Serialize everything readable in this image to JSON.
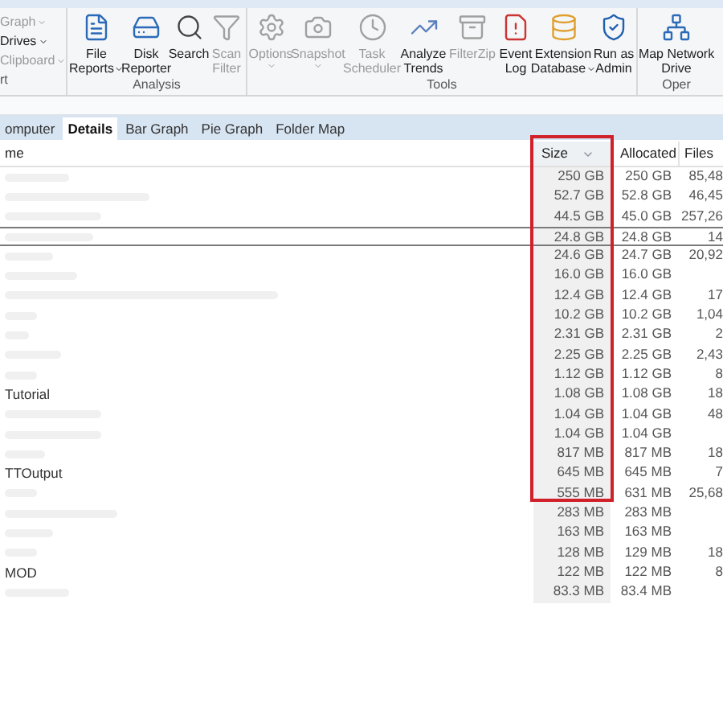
{
  "ribbon": {
    "left_items": [
      {
        "label": "Graph",
        "dropdown": true,
        "disabled": true
      },
      {
        "label": "Drives",
        "dropdown": true,
        "disabled": false
      },
      {
        "label": "Clipboard",
        "dropdown": true,
        "disabled": true
      }
    ],
    "left_group": "rt",
    "groups": [
      {
        "label": "Analysis",
        "buttons": [
          {
            "line1": "File",
            "line2": "Reports",
            "dropdown": true,
            "disabled": false
          },
          {
            "line1": "Disk",
            "line2": "Reporter",
            "dropdown": false,
            "disabled": false
          },
          {
            "line1": "Search",
            "dropdown": false,
            "disabled": false
          },
          {
            "line1": "Scan",
            "line2": "Filter",
            "dropdown": false,
            "disabled": true
          }
        ]
      },
      {
        "label": "Tools",
        "buttons": [
          {
            "line1": "Options",
            "dropdown": true,
            "disabled": true
          },
          {
            "line1": "Snapshot",
            "dropdown": true,
            "disabled": true
          },
          {
            "line1": "Task",
            "line2": "Scheduler",
            "dropdown": false,
            "disabled": true
          },
          {
            "line1": "Analyze",
            "line2": "Trends",
            "dropdown": false,
            "disabled": false
          },
          {
            "line1": "FilterZip",
            "dropdown": false,
            "disabled": true
          },
          {
            "line1": "Event",
            "line2": "Log",
            "dropdown": false,
            "disabled": false
          },
          {
            "line1": "Extension",
            "line2": "Database",
            "dropdown": true,
            "disabled": false
          },
          {
            "line1": "Run as",
            "line2": "Admin",
            "dropdown": false,
            "disabled": false
          }
        ]
      },
      {
        "label": "Oper",
        "buttons": [
          {
            "line1": "Map Network",
            "line2": "Drive",
            "dropdown": false,
            "disabled": false
          }
        ]
      }
    ]
  },
  "tabs": [
    {
      "label": "omputer",
      "selected": false
    },
    {
      "label": "Details",
      "selected": true
    },
    {
      "label": "Bar Graph",
      "selected": false
    },
    {
      "label": "Pie Graph",
      "selected": false
    },
    {
      "label": "Folder Map",
      "selected": false
    }
  ],
  "table": {
    "columns": [
      {
        "label": "me",
        "sorted": false
      },
      {
        "label": "Size",
        "sorted": true
      },
      {
        "label": "Allocated",
        "sorted": false
      },
      {
        "label": "Files",
        "sorted": false
      }
    ],
    "rows": [
      {
        "size": "250 GB",
        "allocated": "250 GB",
        "files": "85,48",
        "selected": false
      },
      {
        "size": "52.7 GB",
        "allocated": "52.8 GB",
        "files": "46,45",
        "selected": false
      },
      {
        "size": "44.5 GB",
        "allocated": "45.0 GB",
        "files": "257,26",
        "selected": false
      },
      {
        "size": "24.8 GB",
        "allocated": "24.8 GB",
        "files": "14",
        "selected": true
      },
      {
        "size": "24.6 GB",
        "allocated": "24.7 GB",
        "files": "20,92",
        "selected": false
      },
      {
        "size": "16.0 GB",
        "allocated": "16.0 GB",
        "selected": false
      },
      {
        "size": "12.4 GB",
        "allocated": "12.4 GB",
        "files": "17",
        "selected": false
      },
      {
        "size": "10.2 GB",
        "allocated": "10.2 GB",
        "files": "1,04",
        "selected": false
      },
      {
        "size": "2.31 GB",
        "allocated": "2.31 GB",
        "files": "2",
        "selected": false
      },
      {
        "size": "2.25 GB",
        "allocated": "2.25 GB",
        "files": "2,43",
        "selected": false
      },
      {
        "size": "1.12 GB",
        "allocated": "1.12 GB",
        "files": "8",
        "selected": false
      },
      {
        "name": "Tutorial",
        "size": "1.08 GB",
        "allocated": "1.08 GB",
        "files": "18",
        "selected": false
      },
      {
        "size": "1.04 GB",
        "allocated": "1.04 GB",
        "files": "48",
        "selected": false
      },
      {
        "size": "1.04 GB",
        "allocated": "1.04 GB",
        "selected": false
      },
      {
        "size": "817 MB",
        "allocated": "817 MB",
        "files": "18",
        "selected": false
      },
      {
        "name": "TTOutput",
        "size": "645 MB",
        "allocated": "645 MB",
        "files": "7",
        "selected": false
      },
      {
        "size": "555 MB",
        "allocated": "631 MB",
        "files": "25,68",
        "selected": false
      },
      {
        "size": "283 MB",
        "allocated": "283 MB",
        "selected": false
      },
      {
        "size": "163 MB",
        "allocated": "163 MB",
        "selected": false
      },
      {
        "size": "128 MB",
        "allocated": "129 MB",
        "files": "18",
        "selected": false
      },
      {
        "name": "MOD",
        "size": "122 MB",
        "allocated": "122 MB",
        "files": "8",
        "selected": false
      },
      {
        "size": "83.3 MB",
        "allocated": "83.4 MB",
        "selected": false
      }
    ]
  }
}
